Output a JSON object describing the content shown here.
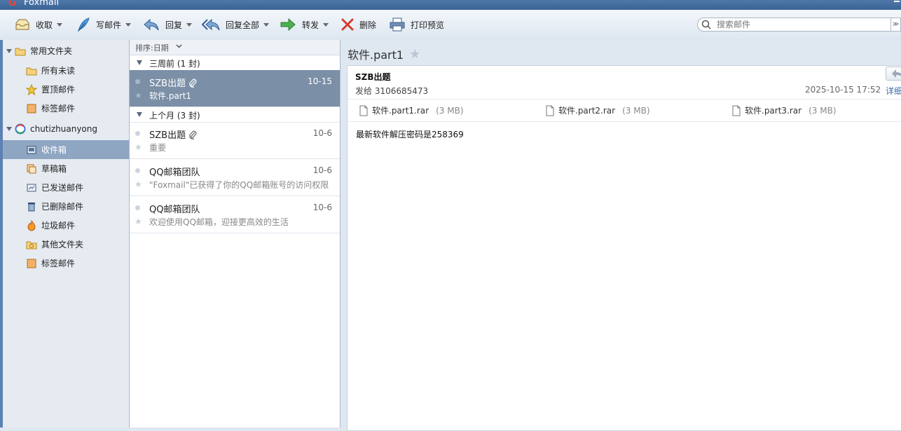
{
  "app": {
    "title": "Foxmail",
    "logo_letter": "G"
  },
  "toolbar": {
    "receive": "收取",
    "compose": "写邮件",
    "reply": "回复",
    "reply_all": "回复全部",
    "forward": "转发",
    "delete": "删除",
    "print_preview": "打印预览"
  },
  "search": {
    "placeholder": "搜索邮件",
    "more_glyph": "≫"
  },
  "sidebar": {
    "common_folder": "常用文件夹",
    "unread_all": "所有未读",
    "pinned": "置顶邮件",
    "tagged": "标签邮件",
    "account": "chutizhuanyong",
    "inbox": "收件箱",
    "drafts": "草稿箱",
    "sent": "已发送邮件",
    "deleted": "已删除邮件",
    "junk": "垃圾邮件",
    "other": "其他文件夹",
    "account_tagged": "标签邮件"
  },
  "list": {
    "sort_label": "排序:日期",
    "groups": [
      {
        "label": "三周前 (1 封)"
      },
      {
        "label": "上个月 (3 封)"
      }
    ],
    "messages": [
      {
        "sender": "SZB出题",
        "date": "10-15",
        "preview": "软件.part1",
        "has_attachment": true
      },
      {
        "sender": "SZB出题",
        "date": "10-6",
        "preview": "重要",
        "has_attachment": true
      },
      {
        "sender": "QQ邮箱团队",
        "date": "10-6",
        "preview": "\"Foxmail\"已获得了你的QQ邮箱账号的访问权限",
        "has_attachment": false
      },
      {
        "sender": "QQ邮箱团队",
        "date": "10-6",
        "preview": "欢迎使用QQ邮箱，迎接更高效的生活",
        "has_attachment": false
      }
    ]
  },
  "reader": {
    "subject": "软件.part1",
    "from": "SZB出题",
    "to_line": "发给 3106685473",
    "datetime": "2025-10-15 17:52",
    "details_link": "详细",
    "attachments": [
      {
        "name": "软件.part1.rar",
        "size": "(3 MB)"
      },
      {
        "name": "软件.part2.rar",
        "size": "(3 MB)"
      },
      {
        "name": "软件.part3.rar",
        "size": "(3 MB)"
      }
    ],
    "body": "最新软件解压密码是258369"
  },
  "colors": {
    "selection": "#7b8fa6",
    "accent": "#3a6496",
    "link": "#3a6aa8"
  }
}
